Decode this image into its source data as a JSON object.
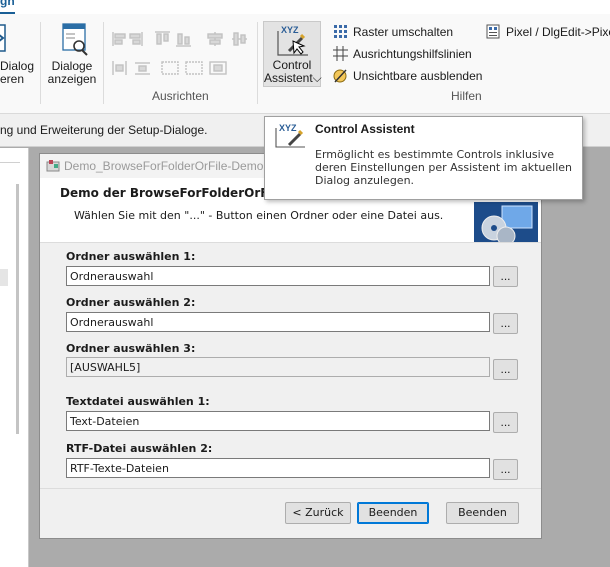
{
  "ribbon": {
    "active_tab": "gn",
    "dialog_button": {
      "line1": "Dialog",
      "line2": "eren"
    },
    "dialoge_button": {
      "line1": "Dialoge",
      "line2": "anzeigen"
    },
    "control_assistant_button": {
      "line1": "Control",
      "line2": "Assistent⌵",
      "icon_text": "XYZ"
    },
    "group_ausrichten": "Ausrichten",
    "group_hilfen": "Hilfen",
    "raster": "Raster umschalten",
    "hilfslinien": "Ausrichtungshilfslinien",
    "unsichtbare": "Unsichtbare ausblenden",
    "pixel": "Pixel / DlgEdit->Pixel"
  },
  "info_bar": {
    "text": "ng und Erweiterung der Setup-Dialoge."
  },
  "tooltip": {
    "icon_text": "XYZ",
    "title": "Control Assistent",
    "body": "Ermöglicht es bestimmte Controls inklusive deren Einstellungen per Assistent im aktuellen Dialog anzulegen."
  },
  "dialog": {
    "title": "Demo_BrowseForFolderOrFile-Demo",
    "header_title": "Demo der BrowseForFolderOrFile CA",
    "header_subtitle": "Wählen Sie mit den \"...\" - Button einen Ordner oder eine Datei aus.",
    "fields": [
      {
        "label": "Ordner auswählen 1:",
        "value": "Ordnerauswahl",
        "readonly": false
      },
      {
        "label": "Ordner auswählen 2:",
        "value": "Ordnerauswahl",
        "readonly": false
      },
      {
        "label": "Ordner auswählen 3:",
        "value": "[AUSWAHL5]",
        "readonly": true
      },
      {
        "label": "Textdatei auswählen 1:",
        "value": "Text-Dateien",
        "readonly": false
      },
      {
        "label": "RTF-Datei auswählen 2:",
        "value": "RTF-Texte-Dateien",
        "readonly": false
      }
    ],
    "browse_label": "...",
    "back_button": "< Zurück",
    "finish_button": "Beenden",
    "cancel_button": "Beenden"
  },
  "colors": {
    "accent": "#1a5f96",
    "tooltip_title": "#1b1b1b"
  }
}
